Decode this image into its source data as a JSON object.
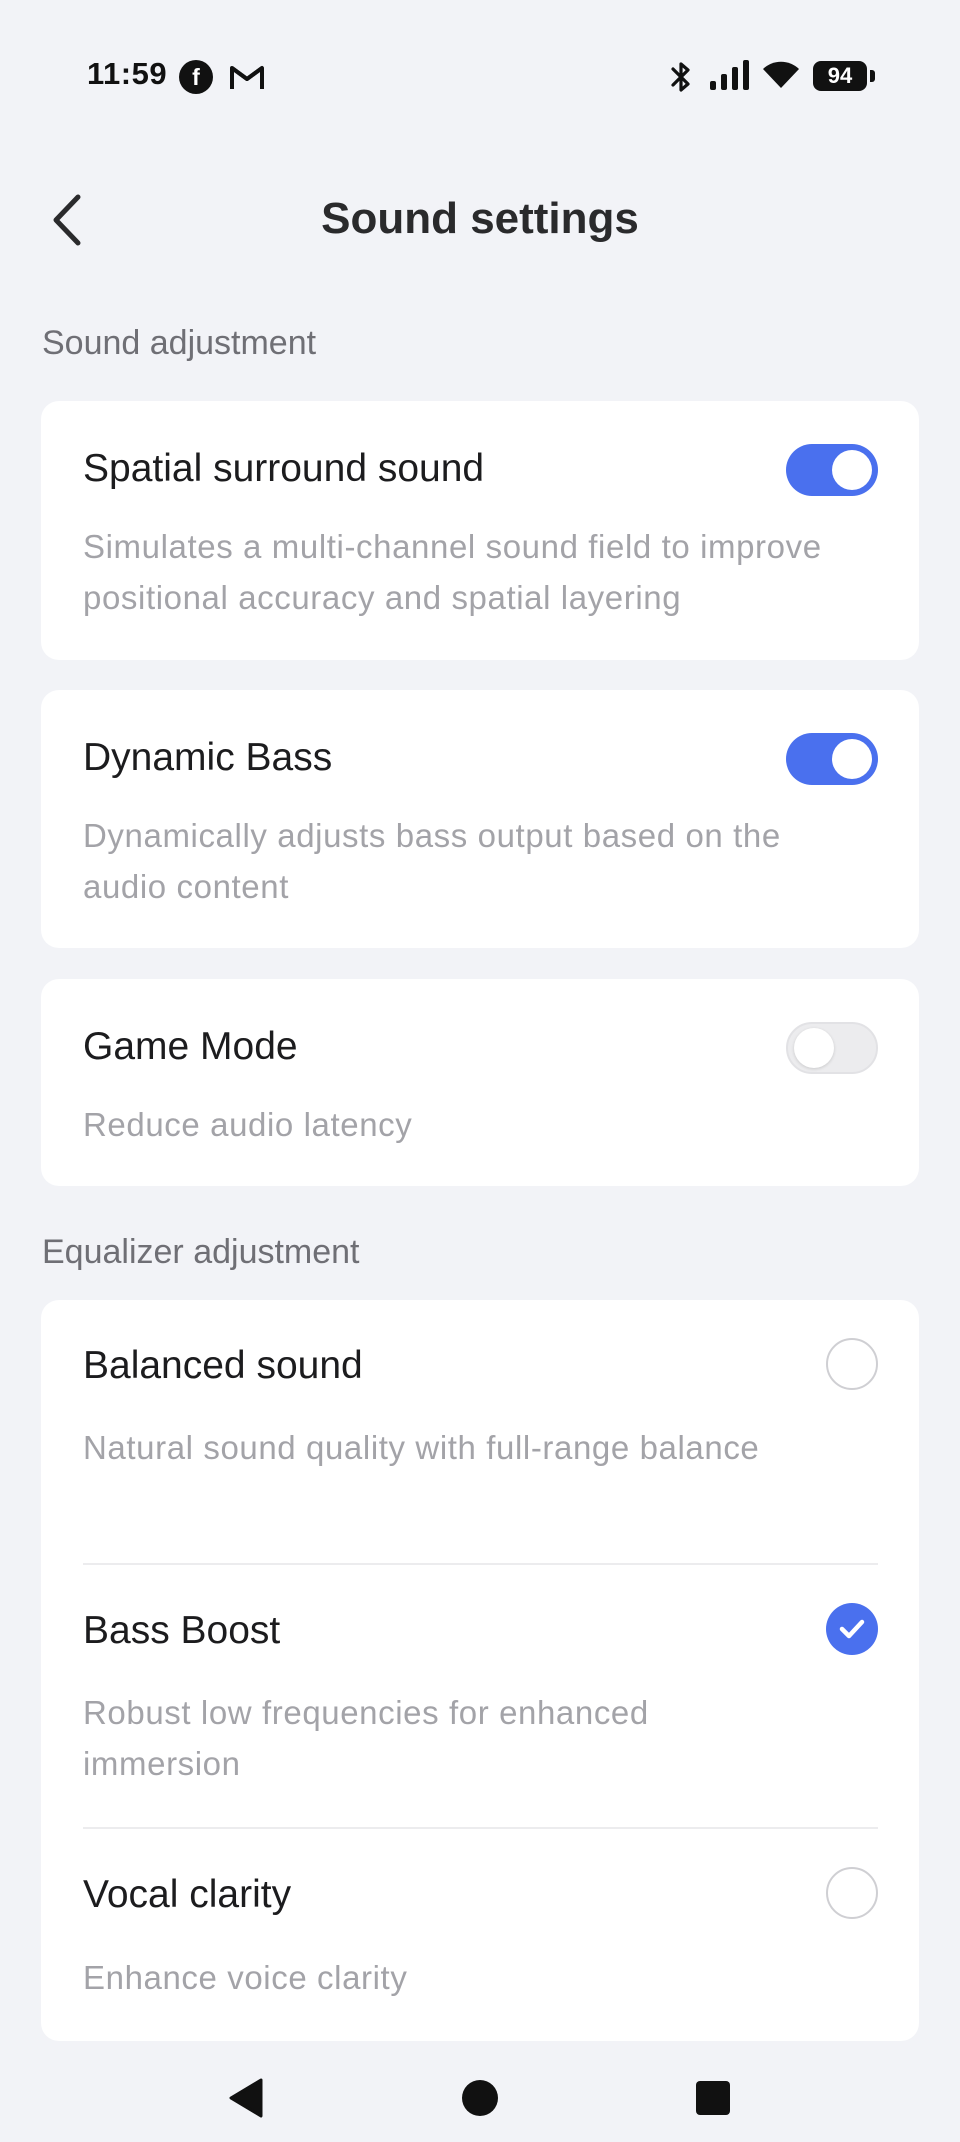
{
  "status_bar": {
    "time": "11:59",
    "facebook_glyph": "f",
    "battery_level": "94"
  },
  "header": {
    "title": "Sound settings",
    "back_icon": "chevron-left-icon"
  },
  "sections": {
    "sound_adjustment": {
      "label": "Sound adjustment",
      "items": [
        {
          "title": "Spatial surround sound",
          "description": "Simulates a multi-channel sound field to improve positional accuracy and spatial layering",
          "enabled": true
        },
        {
          "title": "Dynamic Bass",
          "description": "Dynamically adjusts bass output based on the audio content",
          "enabled": true
        },
        {
          "title": "Game Mode",
          "description": "Reduce audio latency",
          "enabled": false
        }
      ]
    },
    "equalizer": {
      "label": "Equalizer adjustment",
      "options": [
        {
          "title": "Balanced sound",
          "description": "Natural sound quality with full-range balance",
          "selected": false
        },
        {
          "title": "Bass Boost",
          "description": "Robust low frequencies for enhanced immersion",
          "selected": true
        },
        {
          "title": "Vocal clarity",
          "description": "Enhance voice clarity",
          "selected": false
        }
      ]
    }
  },
  "colors": {
    "accent": "#4a70ee",
    "background": "#f2f3f7",
    "card": "#ffffff",
    "secondary_text": "#a3a3a8"
  },
  "nav_bar": {
    "back_icon": "triangle-back-icon",
    "home_icon": "circle-home-icon",
    "recents_icon": "square-recents-icon"
  }
}
